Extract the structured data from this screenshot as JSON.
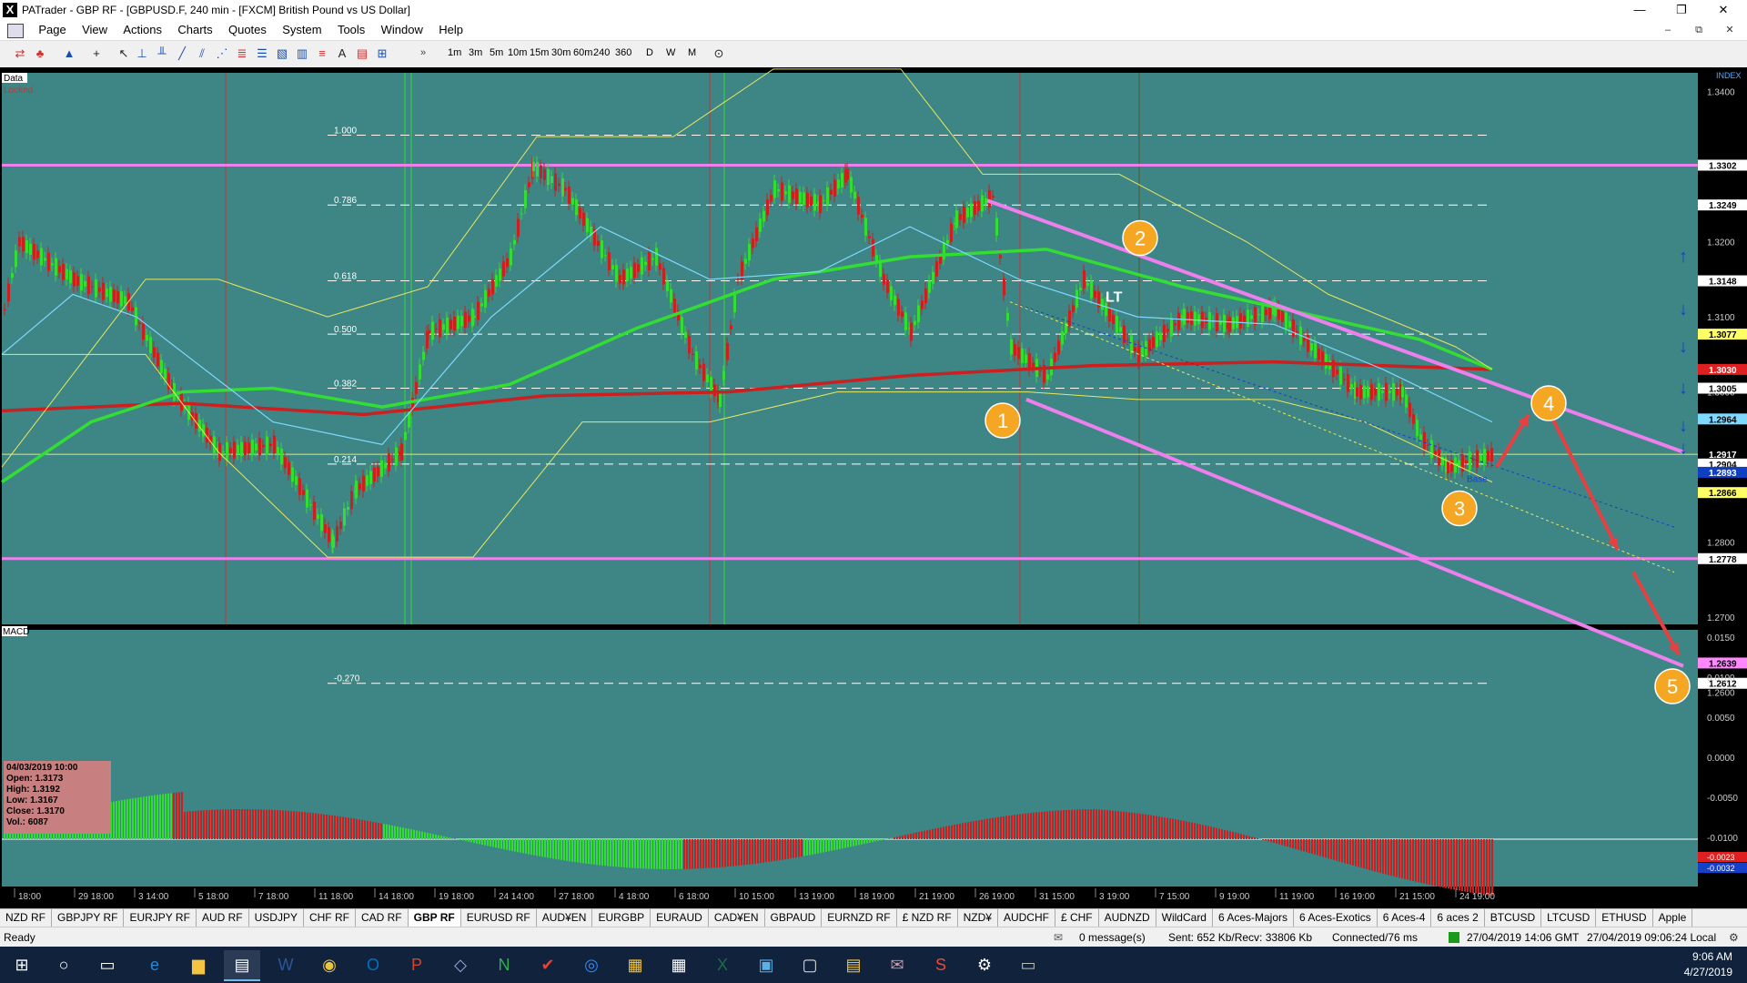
{
  "window": {
    "title": "PATrader - GBP RF - [GBPUSD.F, 240 min - [FXCM] British Pound vs US Dollar]",
    "minimize": "—",
    "restore": "❐",
    "close": "✕",
    "mdi_minimize": "‒",
    "mdi_restore": "⧉",
    "mdi_close": "✕"
  },
  "menu": [
    "Page",
    "View",
    "Actions",
    "Charts",
    "Quotes",
    "System",
    "Tools",
    "Window",
    "Help"
  ],
  "toolbar": {
    "timeframes": [
      "1m",
      "3m",
      "5m",
      "10m",
      "15m",
      "30m",
      "60m",
      "240",
      "360",
      "D",
      "W",
      "M"
    ],
    "more": "»"
  },
  "chart": {
    "data_label": "Data",
    "locked_label": "Locked",
    "index_label": "INDEX",
    "macd_label": "MACD",
    "fib_levels": [
      {
        "label": "1.000",
        "price": 1.3342
      },
      {
        "label": "0.786",
        "price": 1.3249
      },
      {
        "label": "0.618",
        "price": 1.3148
      },
      {
        "label": "0.500",
        "price": 1.3077
      },
      {
        "label": "0.382",
        "price": 1.3005
      },
      {
        "label": "0.214",
        "price": 1.2904
      },
      {
        "label": "-0.270",
        "price": 1.2612
      }
    ],
    "axis_ticks": [
      "1.3400",
      "1.3300",
      "1.3200",
      "1.3100",
      "1.3000",
      "1.2900",
      "1.2800",
      "1.2700",
      "1.2600"
    ],
    "price_tags": [
      {
        "label": "1.3302",
        "price": 1.3302,
        "bg": "#ffffff",
        "fg": "#000000"
      },
      {
        "label": "1.3249",
        "price": 1.3249,
        "bg": "#ffffff",
        "fg": "#000000"
      },
      {
        "label": "1.3148",
        "price": 1.3148,
        "bg": "#ffffff",
        "fg": "#000000"
      },
      {
        "label": "1.3077",
        "price": 1.3077,
        "bg": "#ffff66",
        "fg": "#000000"
      },
      {
        "label": "1.3030",
        "price": 1.303,
        "bg": "#e02020",
        "fg": "#ffffff"
      },
      {
        "label": "1.3005",
        "price": 1.3005,
        "bg": "#ffffff",
        "fg": "#000000"
      },
      {
        "label": "1.2964",
        "price": 1.2964,
        "bg": "#7fd8ff",
        "fg": "#000000"
      },
      {
        "label": "1.2917",
        "price": 1.2917,
        "bg": "#000000",
        "fg": "#ffffff"
      },
      {
        "label": "1.2904",
        "price": 1.2904,
        "bg": "#ffffff",
        "fg": "#000000"
      },
      {
        "label": "1.2893",
        "price": 1.2893,
        "bg": "#1040c0",
        "fg": "#ffffff"
      },
      {
        "label": "1.2866",
        "price": 1.2866,
        "bg": "#ffff66",
        "fg": "#000000"
      },
      {
        "label": "1.2778",
        "price": 1.2778,
        "bg": "#ffffff",
        "fg": "#000000"
      },
      {
        "label": "1.2639",
        "price": 1.2639,
        "bg": "#ff88ff",
        "fg": "#000000"
      },
      {
        "label": "1.2612",
        "price": 1.2612,
        "bg": "#ffffff",
        "fg": "#000000"
      }
    ],
    "macd_ticks": [
      "0.0150",
      "0.0100",
      "0.0050",
      "0.0000",
      "-0.0050",
      "-0.0100"
    ],
    "macd_tags": [
      "-0.0023",
      "-0.0032"
    ],
    "x_labels": [
      "18:00",
      "29 18:00",
      "3 14:00",
      "5 18:00",
      "7 18:00",
      "11 18:00",
      "14 18:00",
      "19 18:00",
      "24 14:00",
      "27 18:00",
      "4 18:00",
      "6 18:00",
      "10 15:00",
      "13 19:00",
      "18 19:00",
      "21 19:00",
      "26 19:00",
      "31 15:00",
      "3 19:00",
      "7 15:00",
      "9 19:00",
      "11 19:00",
      "16 19:00",
      "21 15:00",
      "24 19:00"
    ],
    "ohlc": {
      "date": "04/03/2019 10:00",
      "open": "Open: 1.3173",
      "high": "High: 1.3192",
      "low": "Low: 1.3167",
      "close": "Close: 1.3170",
      "vol": "Vol.: 6087"
    },
    "waves": [
      "1",
      "2",
      "3",
      "4",
      "5"
    ],
    "annotation_lt": "LT",
    "annotation_base": "Base",
    "colors": {
      "background": "#3e8585",
      "pink": "#ee80ee",
      "yellow": "#e8e860",
      "green": "#33dd33",
      "red": "#cc1f1f",
      "cyan": "#7fd8ff",
      "wave": "#f5a623",
      "arrow": "#e84040"
    }
  },
  "symbols": [
    "NZD RF",
    "GBPJPY RF",
    "EURJPY RF",
    "AUD RF",
    "USDJPY",
    "CHF RF",
    "CAD RF",
    "GBP RF",
    "EURUSD RF",
    "AUD¥EN",
    "EURGBP",
    "EURAUD",
    "CAD¥EN",
    "GBPAUD",
    "EURNZD RF",
    "£ NZD RF",
    "NZD¥",
    "AUDCHF",
    "£ CHF",
    "AUDNZD",
    "WildCard",
    "6 Aces-Majors",
    "6 Aces-Exotics",
    "6 Aces-4",
    "6 aces 2",
    "BTCUSD",
    "LTCUSD",
    "ETHUSD",
    "Apple"
  ],
  "active_symbol": "GBP RF",
  "status": {
    "ready": "Ready",
    "messages": "0 message(s)",
    "traffic": "Sent: 652 Kb/Recv: 33806 Kb",
    "connection": "Connected/76 ms",
    "gmt": "27/04/2019 14:06 GMT",
    "local": "27/04/2019 09:06:24 Local"
  },
  "taskbar": {
    "time": "9:06 AM",
    "date": "4/27/2019"
  }
}
